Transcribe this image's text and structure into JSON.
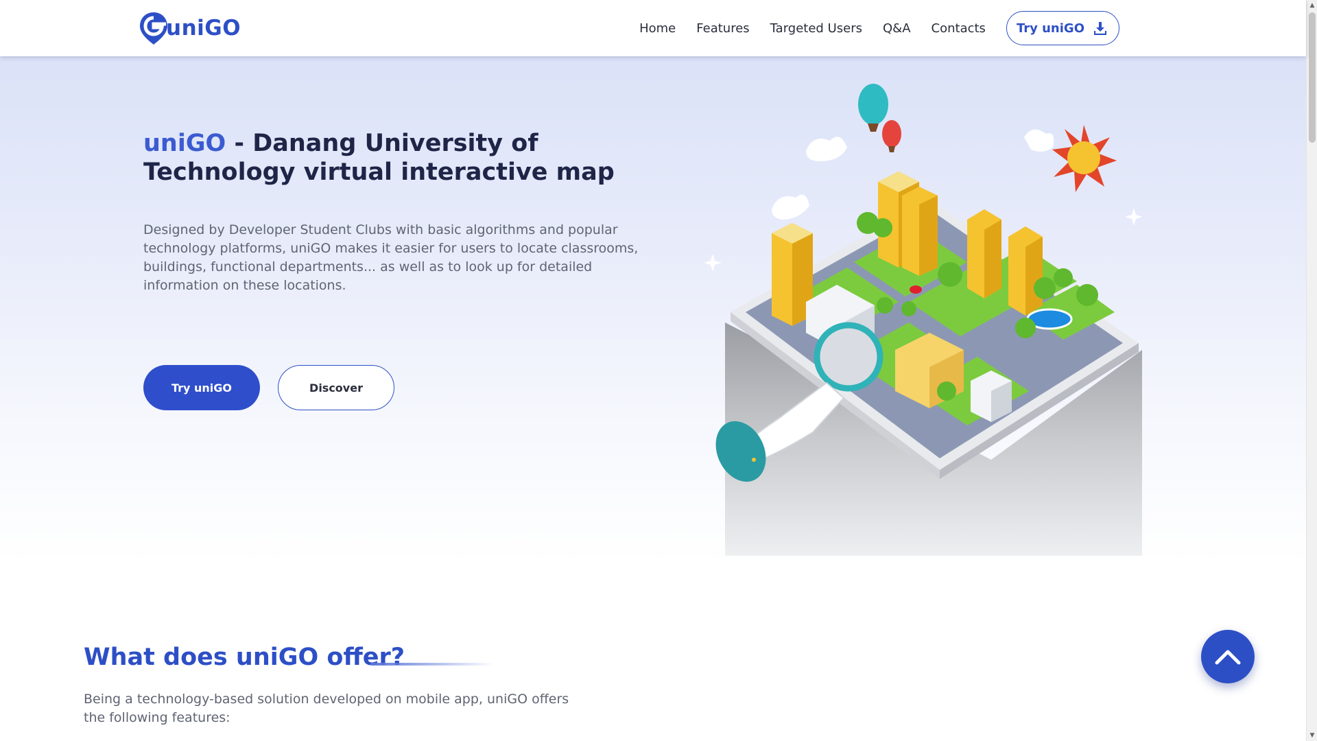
{
  "header": {
    "brand": "uniGO",
    "nav": [
      "Home",
      "Features",
      "Targeted Users",
      "Q&A",
      "Contacts"
    ],
    "cta_label": "Try uniGO",
    "cta_icon": "download-icon"
  },
  "hero": {
    "title_brand": "uniGO",
    "title_rest": " - Danang University of Technology virtual interactive map",
    "description": "Designed by Developer Student Clubs with basic algorithms and popular technology platforms, uniGO makes it easier for users to locate classrooms, buildings, functional departments... as well as to look up for detailed information on these locations.",
    "primary_button": "Try uniGO",
    "secondary_button": "Discover"
  },
  "section": {
    "title": "What does uniGO offer?",
    "description": "Being a technology-based solution developed on mobile app, uniGO offers the following features:"
  },
  "scroll_to_top": {
    "icon": "chevron-up-icon"
  },
  "colors": {
    "brand": "#2d4fc6",
    "title_dark": "#1f2547",
    "body_text": "#5f6472"
  }
}
